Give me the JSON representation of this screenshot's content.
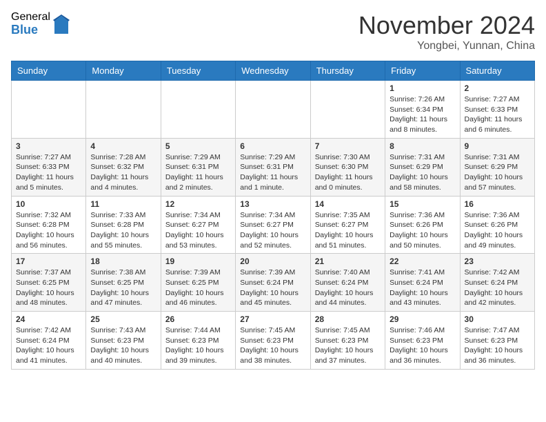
{
  "header": {
    "logo_general": "General",
    "logo_blue": "Blue",
    "month_title": "November 2024",
    "location": "Yongbei, Yunnan, China"
  },
  "weekdays": [
    "Sunday",
    "Monday",
    "Tuesday",
    "Wednesday",
    "Thursday",
    "Friday",
    "Saturday"
  ],
  "weeks": [
    [
      {
        "day": "",
        "info": ""
      },
      {
        "day": "",
        "info": ""
      },
      {
        "day": "",
        "info": ""
      },
      {
        "day": "",
        "info": ""
      },
      {
        "day": "",
        "info": ""
      },
      {
        "day": "1",
        "info": "Sunrise: 7:26 AM\nSunset: 6:34 PM\nDaylight: 11 hours and 8 minutes."
      },
      {
        "day": "2",
        "info": "Sunrise: 7:27 AM\nSunset: 6:33 PM\nDaylight: 11 hours and 6 minutes."
      }
    ],
    [
      {
        "day": "3",
        "info": "Sunrise: 7:27 AM\nSunset: 6:33 PM\nDaylight: 11 hours and 5 minutes."
      },
      {
        "day": "4",
        "info": "Sunrise: 7:28 AM\nSunset: 6:32 PM\nDaylight: 11 hours and 4 minutes."
      },
      {
        "day": "5",
        "info": "Sunrise: 7:29 AM\nSunset: 6:31 PM\nDaylight: 11 hours and 2 minutes."
      },
      {
        "day": "6",
        "info": "Sunrise: 7:29 AM\nSunset: 6:31 PM\nDaylight: 11 hours and 1 minute."
      },
      {
        "day": "7",
        "info": "Sunrise: 7:30 AM\nSunset: 6:30 PM\nDaylight: 11 hours and 0 minutes."
      },
      {
        "day": "8",
        "info": "Sunrise: 7:31 AM\nSunset: 6:29 PM\nDaylight: 10 hours and 58 minutes."
      },
      {
        "day": "9",
        "info": "Sunrise: 7:31 AM\nSunset: 6:29 PM\nDaylight: 10 hours and 57 minutes."
      }
    ],
    [
      {
        "day": "10",
        "info": "Sunrise: 7:32 AM\nSunset: 6:28 PM\nDaylight: 10 hours and 56 minutes."
      },
      {
        "day": "11",
        "info": "Sunrise: 7:33 AM\nSunset: 6:28 PM\nDaylight: 10 hours and 55 minutes."
      },
      {
        "day": "12",
        "info": "Sunrise: 7:34 AM\nSunset: 6:27 PM\nDaylight: 10 hours and 53 minutes."
      },
      {
        "day": "13",
        "info": "Sunrise: 7:34 AM\nSunset: 6:27 PM\nDaylight: 10 hours and 52 minutes."
      },
      {
        "day": "14",
        "info": "Sunrise: 7:35 AM\nSunset: 6:27 PM\nDaylight: 10 hours and 51 minutes."
      },
      {
        "day": "15",
        "info": "Sunrise: 7:36 AM\nSunset: 6:26 PM\nDaylight: 10 hours and 50 minutes."
      },
      {
        "day": "16",
        "info": "Sunrise: 7:36 AM\nSunset: 6:26 PM\nDaylight: 10 hours and 49 minutes."
      }
    ],
    [
      {
        "day": "17",
        "info": "Sunrise: 7:37 AM\nSunset: 6:25 PM\nDaylight: 10 hours and 48 minutes."
      },
      {
        "day": "18",
        "info": "Sunrise: 7:38 AM\nSunset: 6:25 PM\nDaylight: 10 hours and 47 minutes."
      },
      {
        "day": "19",
        "info": "Sunrise: 7:39 AM\nSunset: 6:25 PM\nDaylight: 10 hours and 46 minutes."
      },
      {
        "day": "20",
        "info": "Sunrise: 7:39 AM\nSunset: 6:24 PM\nDaylight: 10 hours and 45 minutes."
      },
      {
        "day": "21",
        "info": "Sunrise: 7:40 AM\nSunset: 6:24 PM\nDaylight: 10 hours and 44 minutes."
      },
      {
        "day": "22",
        "info": "Sunrise: 7:41 AM\nSunset: 6:24 PM\nDaylight: 10 hours and 43 minutes."
      },
      {
        "day": "23",
        "info": "Sunrise: 7:42 AM\nSunset: 6:24 PM\nDaylight: 10 hours and 42 minutes."
      }
    ],
    [
      {
        "day": "24",
        "info": "Sunrise: 7:42 AM\nSunset: 6:24 PM\nDaylight: 10 hours and 41 minutes."
      },
      {
        "day": "25",
        "info": "Sunrise: 7:43 AM\nSunset: 6:23 PM\nDaylight: 10 hours and 40 minutes."
      },
      {
        "day": "26",
        "info": "Sunrise: 7:44 AM\nSunset: 6:23 PM\nDaylight: 10 hours and 39 minutes."
      },
      {
        "day": "27",
        "info": "Sunrise: 7:45 AM\nSunset: 6:23 PM\nDaylight: 10 hours and 38 minutes."
      },
      {
        "day": "28",
        "info": "Sunrise: 7:45 AM\nSunset: 6:23 PM\nDaylight: 10 hours and 37 minutes."
      },
      {
        "day": "29",
        "info": "Sunrise: 7:46 AM\nSunset: 6:23 PM\nDaylight: 10 hours and 36 minutes."
      },
      {
        "day": "30",
        "info": "Sunrise: 7:47 AM\nSunset: 6:23 PM\nDaylight: 10 hours and 36 minutes."
      }
    ]
  ]
}
